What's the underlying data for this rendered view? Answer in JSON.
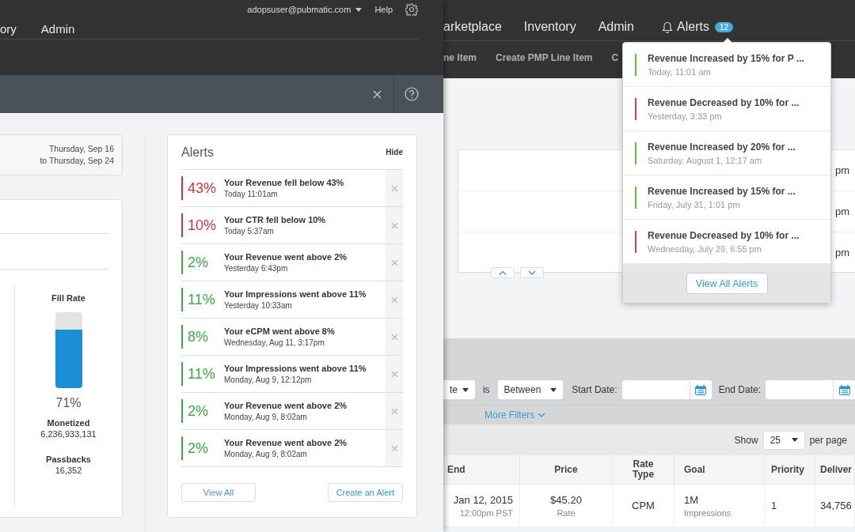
{
  "left_screen": {
    "header": {
      "user_menu": "adopsuser@pubmatic.com",
      "help_link": "Help",
      "nav": [
        {
          "label": "ory"
        },
        {
          "label": "Admin"
        }
      ]
    },
    "date_range": {
      "start": "Thursday, Sep 16",
      "end": "to Thursday, Sep 24"
    },
    "fill_rate": {
      "title": "Fill Rate",
      "level": 0.77,
      "reading": "71%",
      "stats": [
        {
          "label": "Monetized",
          "value": "6,236,933,131"
        },
        {
          "label": "Passbacks",
          "value": "16,352"
        }
      ]
    },
    "alerts_panel": {
      "title": "Alerts",
      "hide": "Hide",
      "items": [
        {
          "percent": "43%",
          "title": "Your Revenue fell below 43%",
          "time": "Today 11:01am",
          "color": "#d0343c"
        },
        {
          "percent": "10%",
          "title": "Your CTR fell below 10%",
          "time": "Today 5:37am",
          "color": "#d0343c"
        },
        {
          "percent": "2%",
          "title": "Your Revenue went above 2%",
          "time": "Yesterday 6:43pm",
          "color": "#3fa845"
        },
        {
          "percent": "11%",
          "title": "Your Impressions went above 11%",
          "time": "Yesterday 10:33am",
          "color": "#3fa845"
        },
        {
          "percent": "8%",
          "title": "Your eCPM went above 8%",
          "time": "Wednesday, Aug 11, 3:17pm",
          "color": "#3fa845"
        },
        {
          "percent": "11%",
          "title": "Your Impressions went above 11%",
          "time": "Monday, Aug 9, 12:12pm",
          "color": "#3fa845"
        },
        {
          "percent": "2%",
          "title": "Your Revenue went above 2%",
          "time": "Monday, Aug 9, 8:02am",
          "color": "#3fa845"
        },
        {
          "percent": "2%",
          "title": "Your Revenue went above 2%",
          "time": "Monday, Aug 9, 8:02am",
          "color": "#3fa845"
        }
      ],
      "buttons": [
        "View All",
        "Create an Alert"
      ]
    }
  },
  "right_screen": {
    "nav": [
      {
        "label": "arketplace"
      },
      {
        "label": "Inventory"
      },
      {
        "label": "Admin"
      }
    ],
    "alerts_menu": {
      "label": "Alerts",
      "badge": "12"
    },
    "subnav": [
      {
        "label": "ne Item"
      },
      {
        "label": "Create PMP Line Item"
      },
      {
        "label": "C"
      }
    ],
    "list_times": [
      "pm",
      "pm",
      "pm"
    ],
    "alerts_dropdown": {
      "items": [
        {
          "title": "Revenue Increased by 15% for P ...",
          "time": "Today, 11:01 am",
          "color": "#6cb83f"
        },
        {
          "title": "Revenue Decreased by 10% for ...",
          "time": "Yesterday, 3:33 pm",
          "color": "#d2474d"
        },
        {
          "title": "Revenue Increased by 20% for ...",
          "time": "Saturday, August 1, 12:17 am",
          "color": "#6cb83f"
        },
        {
          "title": "Revenue Increased by 15% for ...",
          "time": "Friday, July 31, 1:01 pm",
          "color": "#6cb83f"
        },
        {
          "title": "Revenue Decreased by 10% for ...",
          "time": "Wednesday, July 29, 6:55 pm",
          "color": "#d2474d"
        }
      ],
      "button": "View All Alerts"
    },
    "filters": {
      "field_select": "te",
      "operator_label": "is",
      "operator_select": "Between",
      "start_label": "Start Date:",
      "end_label": "End Date:",
      "more_filters": "More Filters"
    },
    "pagination": {
      "show_label": "Show",
      "page_size": "25",
      "per_page_label": "per page"
    },
    "table": {
      "columns": [
        "End",
        "Price",
        "Rate Type",
        "Goal",
        "Priority",
        "Deliver"
      ],
      "rows": [
        {
          "cells": [
            {
              "main": "Jan 12, 2015",
              "sub": "12:00pm PST"
            },
            {
              "main": "$45.20",
              "sub": "Rate"
            },
            {
              "main": "CPM"
            },
            {
              "main": "1M",
              "sub": "Impressions"
            },
            {
              "main": "1"
            },
            {
              "main": "34,756"
            }
          ]
        }
      ]
    }
  }
}
